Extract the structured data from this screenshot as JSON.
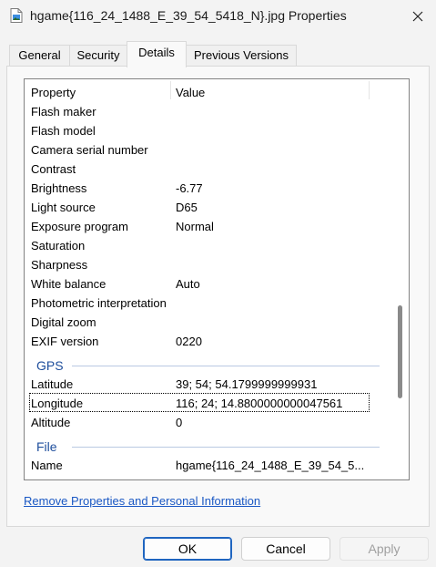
{
  "window": {
    "title": "hgame{116_24_1488_E_39_54_5418_N}.jpg Properties",
    "close_icon": "close-icon"
  },
  "tabs": [
    {
      "label": "General"
    },
    {
      "label": "Security"
    },
    {
      "label": "Details",
      "active": true
    },
    {
      "label": "Previous Versions"
    }
  ],
  "list": {
    "header": {
      "property": "Property",
      "value": "Value"
    },
    "rows": [
      {
        "type": "row",
        "key": "Flash maker",
        "value": ""
      },
      {
        "type": "row",
        "key": "Flash model",
        "value": ""
      },
      {
        "type": "row",
        "key": "Camera serial number",
        "value": ""
      },
      {
        "type": "row",
        "key": "Contrast",
        "value": ""
      },
      {
        "type": "row",
        "key": "Brightness",
        "value": "-6.77"
      },
      {
        "type": "row",
        "key": "Light source",
        "value": "D65"
      },
      {
        "type": "row",
        "key": "Exposure program",
        "value": "Normal"
      },
      {
        "type": "row",
        "key": "Saturation",
        "value": ""
      },
      {
        "type": "row",
        "key": "Sharpness",
        "value": ""
      },
      {
        "type": "row",
        "key": "White balance",
        "value": "Auto"
      },
      {
        "type": "row",
        "key": "Photometric interpretation",
        "value": ""
      },
      {
        "type": "row",
        "key": "Digital zoom",
        "value": ""
      },
      {
        "type": "row",
        "key": "EXIF version",
        "value": "0220"
      },
      {
        "type": "group",
        "key": "GPS"
      },
      {
        "type": "row",
        "key": "Latitude",
        "value": "39; 54; 54.1799999999931"
      },
      {
        "type": "row",
        "key": "Longitude",
        "value": "116; 24; 14.8800000000047561",
        "focused": true
      },
      {
        "type": "row",
        "key": "Altitude",
        "value": "0"
      },
      {
        "type": "group",
        "key": "File"
      },
      {
        "type": "row",
        "key": "Name",
        "value": "hgame{116_24_1488_E_39_54_5..."
      }
    ]
  },
  "link": {
    "label": "Remove Properties and Personal Information"
  },
  "buttons": {
    "ok": "OK",
    "cancel": "Cancel",
    "apply": "Apply"
  },
  "colors": {
    "accent": "#1f65c0",
    "group_label": "#1e4e9c",
    "link": "#1a58c4"
  }
}
